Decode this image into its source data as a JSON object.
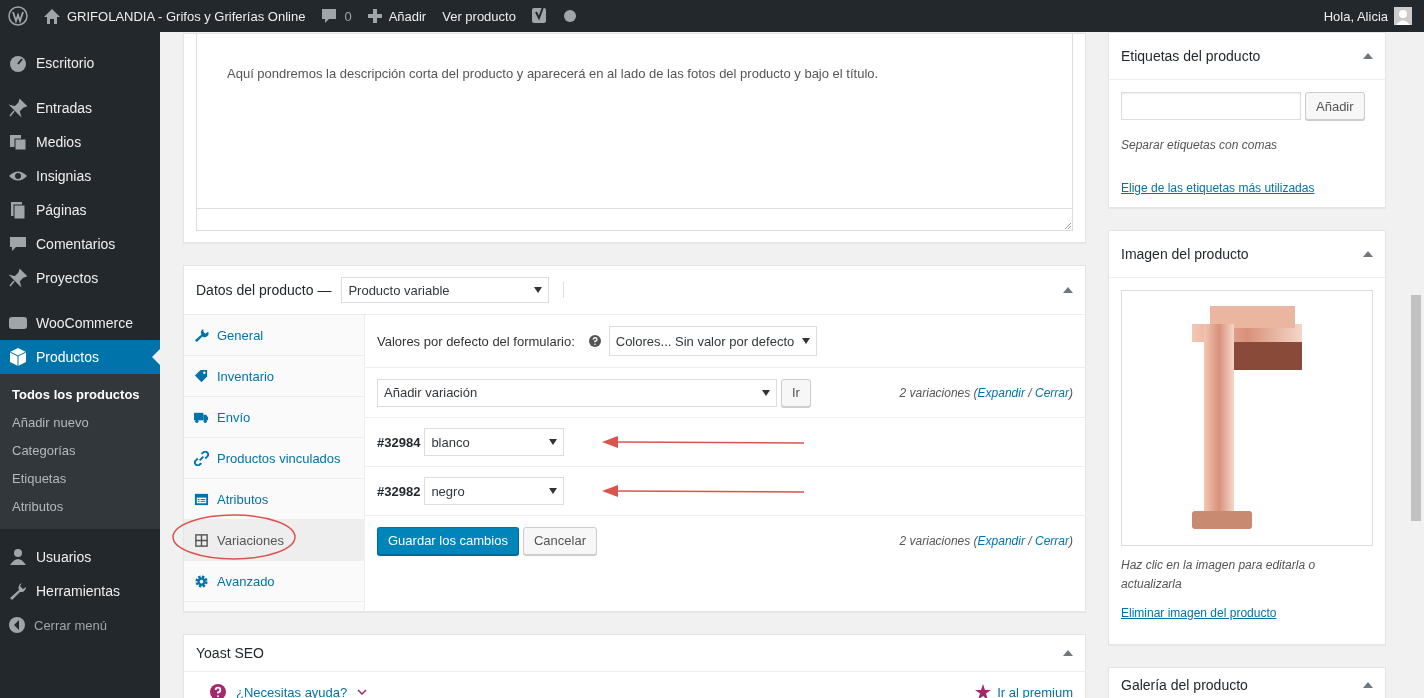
{
  "admin_bar": {
    "site_name": "GRIFOLANDIA - Grifos y Griferías Online",
    "comments_count": "0",
    "add_new": "Añadir",
    "view_product": "Ver producto",
    "greeting": "Hola, Alicia"
  },
  "sidebar": {
    "items": [
      {
        "label": "Escritorio",
        "selected": false
      },
      {
        "label": "Entradas",
        "selected": false
      },
      {
        "label": "Medios",
        "selected": false
      },
      {
        "label": "Insignias",
        "selected": false
      },
      {
        "label": "Páginas",
        "selected": false
      },
      {
        "label": "Comentarios",
        "selected": false
      },
      {
        "label": "Proyectos",
        "selected": false
      },
      {
        "label": "WooCommerce",
        "selected": false
      },
      {
        "label": "Productos",
        "selected": true,
        "children": [
          {
            "label": "Todos los productos",
            "selected": true
          },
          {
            "label": "Añadir nuevo",
            "selected": false
          },
          {
            "label": "Categorías",
            "selected": false
          },
          {
            "label": "Etiquetas",
            "selected": false
          },
          {
            "label": "Atributos",
            "selected": false
          }
        ]
      },
      {
        "label": "Usuarios",
        "selected": false
      },
      {
        "label": "Herramientas",
        "selected": false
      }
    ],
    "collapse": "Cerrar menú"
  },
  "short_description": {
    "text": "Aquí pondremos la descripción corta del producto y aparecerá en al lado de las fotos del producto y bajo el título."
  },
  "product_data": {
    "title": "Datos del producto —",
    "product_type": "Producto variable",
    "tabs": [
      {
        "label": "General",
        "selected": false
      },
      {
        "label": "Inventario",
        "selected": false
      },
      {
        "label": "Envío",
        "selected": false
      },
      {
        "label": "Productos vinculados",
        "selected": false
      },
      {
        "label": "Atributos",
        "selected": false
      },
      {
        "label": "Variaciones",
        "selected": true
      },
      {
        "label": "Avanzado",
        "selected": false
      }
    ],
    "defaults_label": "Valores por defecto del formulario:",
    "defaults_value": "Colores... Sin valor por defecto",
    "action_select": "Añadir variación",
    "go_button": "Ir",
    "count_text": "2 variaciones (",
    "expand_link": "Expandir",
    "separator": " / ",
    "close_link": "Cerrar",
    "close_paren": ")",
    "variations": [
      {
        "id": "#32984",
        "value": "blanco"
      },
      {
        "id": "#32982",
        "value": "negro"
      }
    ],
    "save_button": "Guardar los cambios",
    "cancel_button": "Cancelar",
    "bottom_count_text": "2 variaciones (",
    "bottom_expand_link": "Expandir",
    "bottom_separator": " / ",
    "bottom_close_link": "Cerrar",
    "bottom_close_paren": ")"
  },
  "yoast": {
    "title": "Yoast SEO",
    "help_link": "¿Necesitas ayuda?",
    "premium_link": "Ir al premium"
  },
  "tags_box": {
    "title": "Etiquetas del producto",
    "add_button": "Añadir",
    "hint": "Separar etiquetas con comas",
    "choose_link": "Elige de las etiquetas más utilizadas"
  },
  "image_box": {
    "title": "Imagen del producto",
    "hint": "Haz clic en la imagen para editarla o actualizarla",
    "remove_link": "Eliminar imagen del producto"
  },
  "gallery_box": {
    "title": "Galería del producto"
  }
}
